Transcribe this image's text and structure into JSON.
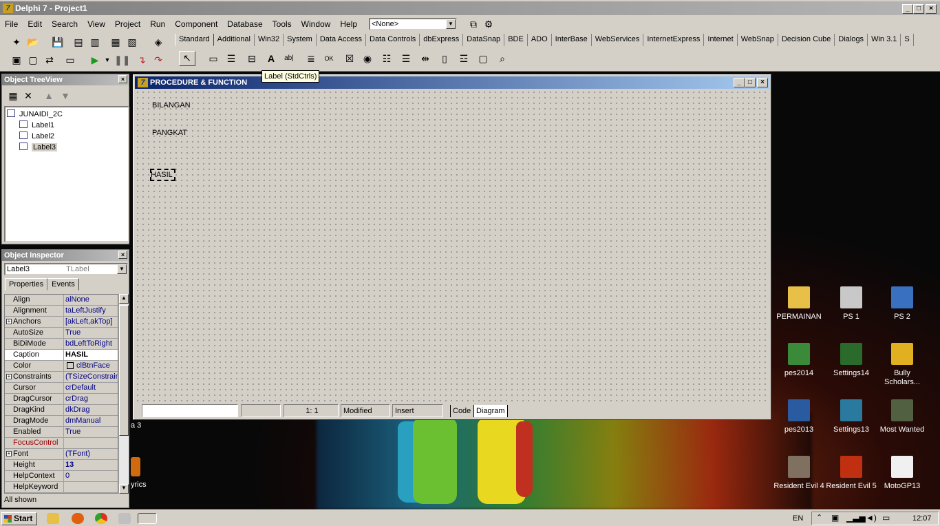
{
  "app": {
    "title": "Delphi 7 - Project1"
  },
  "menu": [
    "File",
    "Edit",
    "Search",
    "View",
    "Project",
    "Run",
    "Component",
    "Database",
    "Tools",
    "Window",
    "Help"
  ],
  "toolbar": {
    "component_combo": "<None>"
  },
  "palette": {
    "tabs": [
      "Standard",
      "Additional",
      "Win32",
      "System",
      "Data Access",
      "Data Controls",
      "dbExpress",
      "DataSnap",
      "BDE",
      "ADO",
      "InterBase",
      "WebServices",
      "InternetExpress",
      "Internet",
      "WebSnap",
      "Decision Cube",
      "Dialogs",
      "Win 3.1",
      "S"
    ],
    "active_tab": "Standard",
    "tooltip": "Label (StdCtrls)"
  },
  "treeview": {
    "title": "Object TreeView",
    "root": "JUNAIDI_2C",
    "items": [
      "Label1",
      "Label2",
      "Label3"
    ],
    "selected": "Label3"
  },
  "inspector": {
    "title": "Object Inspector",
    "object_name": "Label3",
    "object_type": "TLabel",
    "tabs": [
      "Properties",
      "Events"
    ],
    "rows": [
      {
        "name": "Align",
        "value": "alNone"
      },
      {
        "name": "Alignment",
        "value": "taLeftJustify"
      },
      {
        "name": "Anchors",
        "value": "[akLeft,akTop]"
      },
      {
        "name": "AutoSize",
        "value": "True"
      },
      {
        "name": "BiDiMode",
        "value": "bdLeftToRight"
      },
      {
        "name": "Caption",
        "value": "HASIL"
      },
      {
        "name": "Color",
        "value": "clBtnFace"
      },
      {
        "name": "Constraints",
        "value": "(TSizeConstraints)"
      },
      {
        "name": "Cursor",
        "value": "crDefault"
      },
      {
        "name": "DragCursor",
        "value": "crDrag"
      },
      {
        "name": "DragKind",
        "value": "dkDrag"
      },
      {
        "name": "DragMode",
        "value": "dmManual"
      },
      {
        "name": "Enabled",
        "value": "True"
      },
      {
        "name": "FocusControl",
        "value": ""
      },
      {
        "name": "Font",
        "value": "(TFont)"
      },
      {
        "name": "Height",
        "value": "13"
      },
      {
        "name": "HelpContext",
        "value": "0"
      },
      {
        "name": "HelpKeyword",
        "value": ""
      }
    ],
    "status": "All shown"
  },
  "form": {
    "title": "PROCEDURE &  FUNCTION",
    "labels": [
      "BILANGAN",
      "PANGKAT",
      "HASIL"
    ],
    "status": {
      "position": "1:   1",
      "modified": "Modified",
      "mode": "Insert",
      "tab_code": "Code",
      "tab_diagram": "Diagram"
    }
  },
  "desktop": {
    "icons": [
      {
        "label": "PERMAINAN",
        "icon": "folder-icon",
        "color": "#e8c048"
      },
      {
        "label": "PS 1",
        "icon": "ps1-icon",
        "color": "#c8c8c8"
      },
      {
        "label": "PS 2",
        "icon": "ps2-icon",
        "color": "#3a70c0"
      },
      {
        "label": "pes2014",
        "icon": "pes2014-icon",
        "color": "#3a8a3a"
      },
      {
        "label": "Settings14",
        "icon": "settings14-icon",
        "color": "#2a6a2a"
      },
      {
        "label": "Bully Scholars...",
        "icon": "bully-icon",
        "color": "#e0b020"
      },
      {
        "label": "pes2013",
        "icon": "pes2013-icon",
        "color": "#2a5aa0"
      },
      {
        "label": "Settings13",
        "icon": "settings13-icon",
        "color": "#2a7aa0"
      },
      {
        "label": "Most Wanted",
        "icon": "mostwanted-icon",
        "color": "#506040"
      },
      {
        "label": "Resident Evil 4",
        "icon": "re4-icon",
        "color": "#807060"
      },
      {
        "label": "Resident Evil 5",
        "icon": "re5-icon",
        "color": "#c03010"
      },
      {
        "label": "MotoGP13",
        "icon": "motogp-icon",
        "color": "#f0f0f0"
      }
    ],
    "partial_labels": [
      "a 3",
      "yrics"
    ]
  },
  "taskbar": {
    "start": "Start",
    "language": "EN",
    "clock": "12:07"
  }
}
